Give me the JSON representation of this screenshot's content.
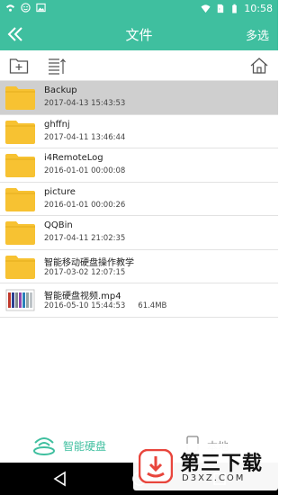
{
  "colors": {
    "accent": "#3fbf9f",
    "folder": "#f7c232",
    "selected_row": "#cfcfcf"
  },
  "status_bar": {
    "time": "10:58"
  },
  "app_bar": {
    "title": "文件",
    "multi_select_label": "多选"
  },
  "files": [
    {
      "name": "Backup",
      "date": "2017-04-13 15:43:53",
      "type": "folder",
      "selected": true
    },
    {
      "name": "ghffnj",
      "date": "2017-04-11 13:46:44",
      "type": "folder",
      "selected": false
    },
    {
      "name": "i4RemoteLog",
      "date": "2016-01-01 00:00:08",
      "type": "folder",
      "selected": false
    },
    {
      "name": "picture",
      "date": "2016-01-01 00:00:26",
      "type": "folder",
      "selected": false
    },
    {
      "name": "QQBin",
      "date": "2017-04-11 21:02:35",
      "type": "folder",
      "selected": false
    },
    {
      "name": "智能移动硬盘操作教学",
      "date": "2017-03-02 12:07:15",
      "type": "folder",
      "selected": false
    },
    {
      "name": "智能硬盘视频.mp4",
      "date": "2016-05-10 15:44:53",
      "size": "61.4MB",
      "type": "video",
      "selected": false
    }
  ],
  "bottom_nav": {
    "disk_label": "智能硬盘",
    "local_label": "本地"
  },
  "watermark": {
    "title": "第三下载",
    "subtitle": "D3XZ.COM"
  }
}
